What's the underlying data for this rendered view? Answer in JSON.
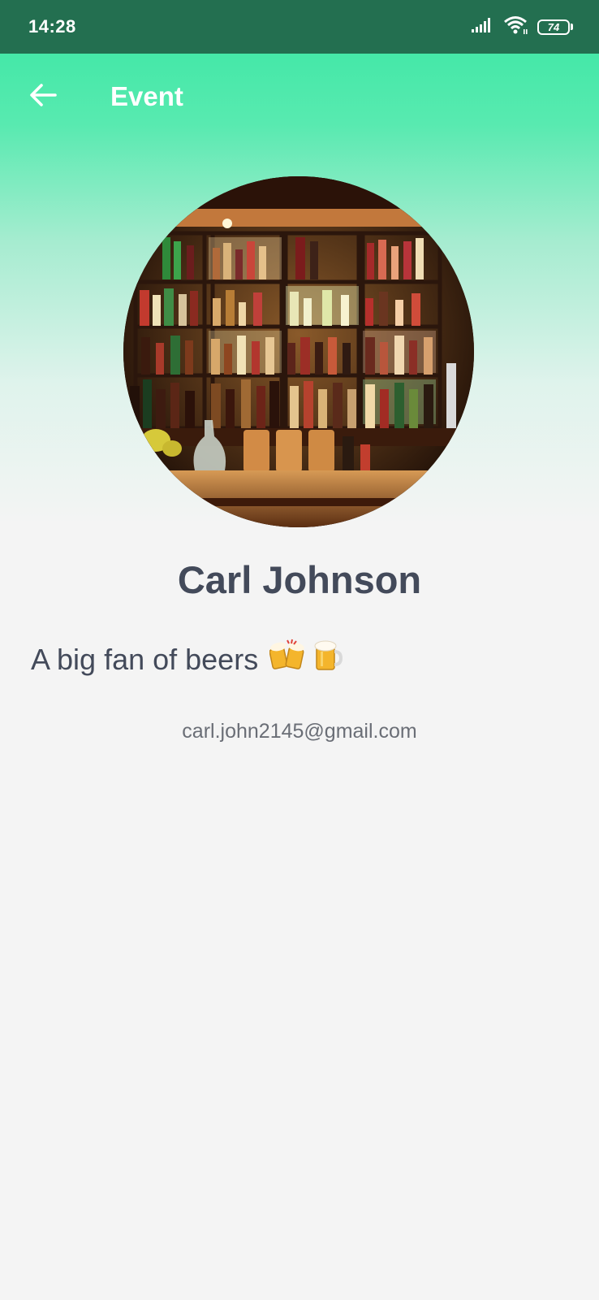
{
  "status_bar": {
    "time": "14:28",
    "battery_level": "74",
    "icons": [
      "signal-icon",
      "wifi-icon",
      "battery-icon"
    ]
  },
  "app_bar": {
    "title": "Event",
    "back_icon": "arrow-left-icon"
  },
  "profile": {
    "avatar_subject": "bar shelves with bottles",
    "name": "Carl Johnson",
    "bio": "A big fan of beers",
    "bio_icons": [
      "clinking-beer-mugs-icon",
      "beer-mug-icon"
    ],
    "email": "carl.john2145@gmail.com"
  },
  "colors": {
    "status_bar": "#236f50",
    "header_gradient_top": "#45e8a8",
    "background": "#f4f4f4",
    "text_primary": "#434a5a",
    "text_secondary": "#6a6e76"
  }
}
